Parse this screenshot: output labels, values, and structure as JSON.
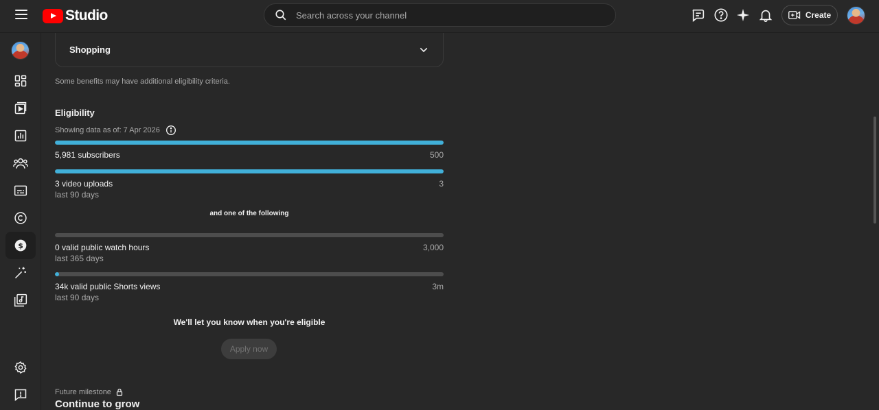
{
  "app": {
    "logo_text": "Studio"
  },
  "header": {
    "search_placeholder": "Search across your channel",
    "create_label": "Create"
  },
  "sidebar": {
    "items": [
      {
        "name": "dashboard-icon"
      },
      {
        "name": "content-icon"
      },
      {
        "name": "analytics-icon"
      },
      {
        "name": "community-icon"
      },
      {
        "name": "subtitles-icon"
      },
      {
        "name": "copyright-icon"
      },
      {
        "name": "earn-icon",
        "active": true
      },
      {
        "name": "customization-icon"
      },
      {
        "name": "audio-library-icon"
      }
    ]
  },
  "main": {
    "shopping_title": "Shopping",
    "note": "Some benefits may have additional eligibility criteria.",
    "eligibility_title": "Eligibility",
    "as_of": "Showing data as of: 7 Apr 2026",
    "requirements": [
      {
        "label": "5,981 subscribers",
        "target": "500",
        "sub": "",
        "progress": 1.0
      },
      {
        "label": "3 video uploads",
        "target": "3",
        "sub": "last 90 days",
        "progress": 1.0
      },
      {
        "label": "0 valid public watch hours",
        "target": "3,000",
        "sub": "last 365 days",
        "progress": 0.0
      },
      {
        "label": "34k valid public Shorts views",
        "target": "3m",
        "sub": "last 90 days",
        "progress": 0.011
      }
    ],
    "and_one": "and one of the following",
    "let_know": "We'll let you know when you're eligible",
    "apply_label": "Apply now",
    "future_label": "Future milestone",
    "continue_title": "Continue to grow"
  },
  "colors": {
    "progress": "#41b0d9",
    "track": "#4d4d4d",
    "brand": "#ff0000"
  }
}
